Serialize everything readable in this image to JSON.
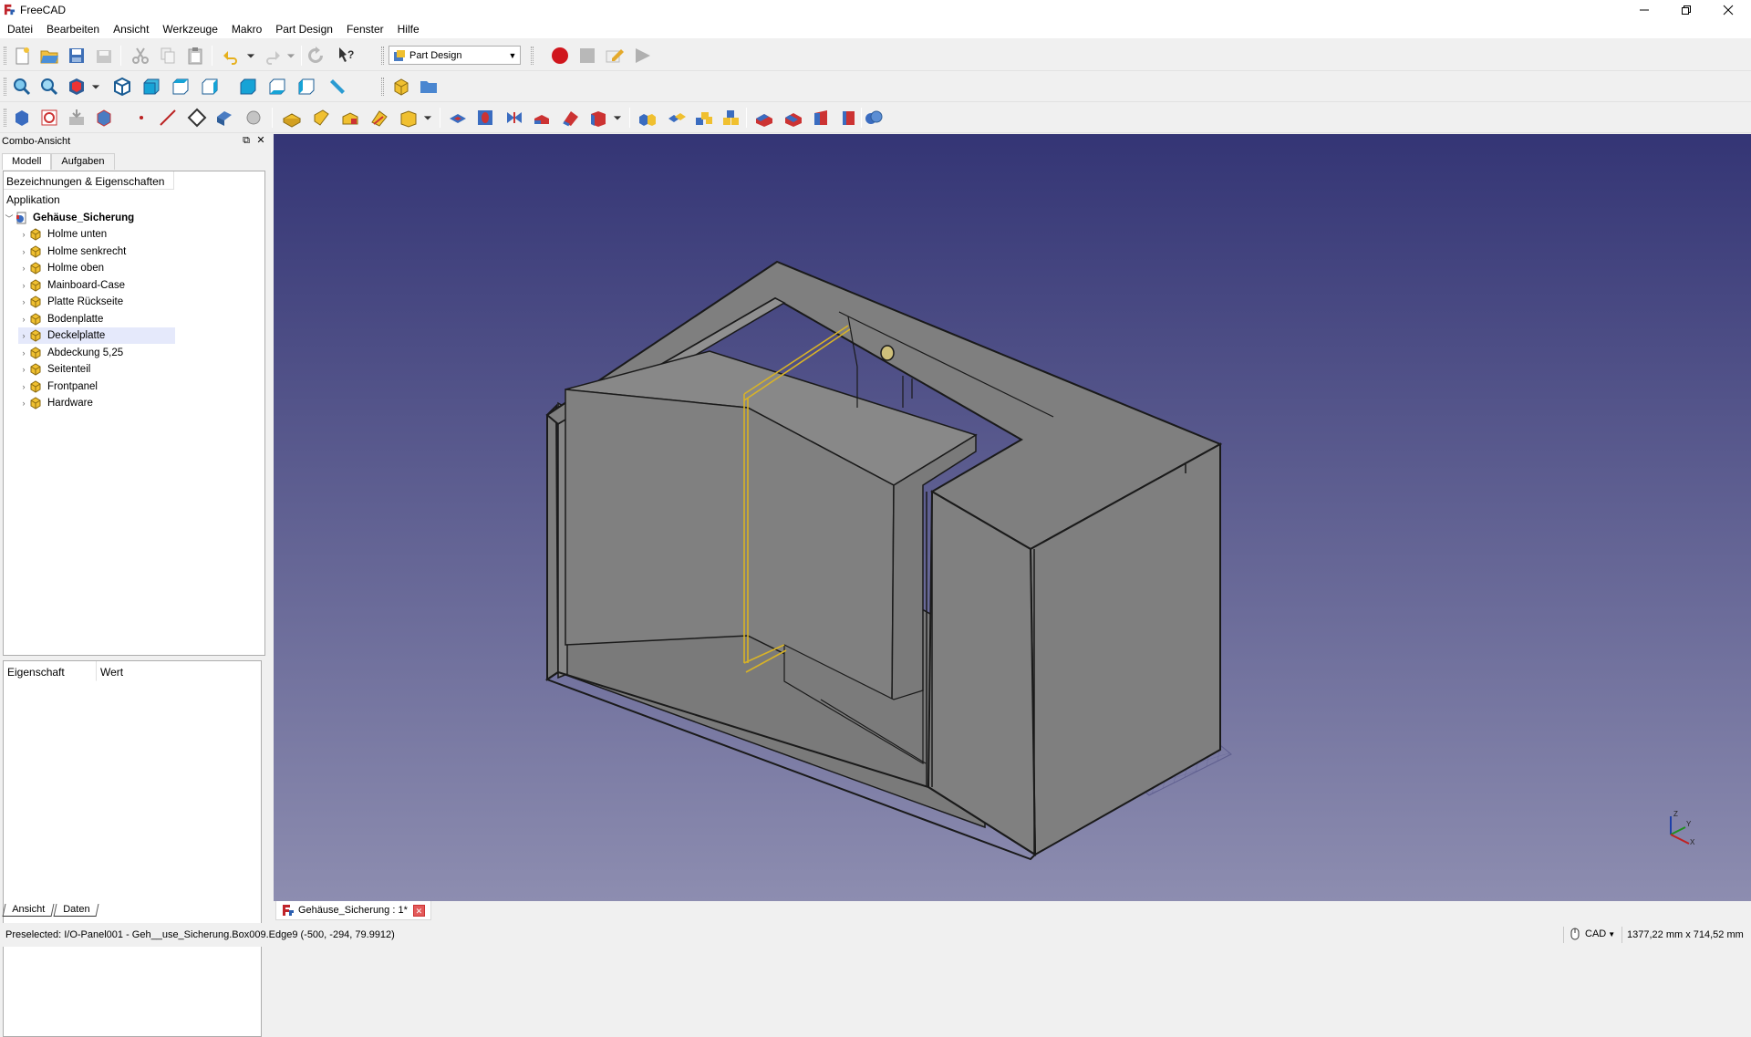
{
  "window": {
    "title": "FreeCAD",
    "controls": [
      "minimize",
      "restore",
      "close"
    ]
  },
  "menu": [
    "Datei",
    "Bearbeiten",
    "Ansicht",
    "Werkzeuge",
    "Makro",
    "Part Design",
    "Fenster",
    "Hilfe"
  ],
  "workbench": {
    "selected": "Part Design"
  },
  "toolbar_icons": {
    "row1": [
      "new-document-icon",
      "open-icon",
      "save-icon",
      "save-as-icon",
      "cut-icon",
      "copy-icon",
      "paste-icon",
      "undo-icon",
      "redo-icon",
      "refresh-icon",
      "whats-this-icon",
      "macro-record-icon",
      "macro-stop-icon",
      "macro-edit-icon",
      "macro-run-icon"
    ],
    "row2": [
      "fit-all-icon",
      "fit-selection-icon",
      "draw-style-icon",
      "isometric-view-icon",
      "front-view-icon",
      "top-view-icon",
      "right-view-icon",
      "rear-view-icon",
      "bottom-view-icon",
      "left-view-icon",
      "measure-distance-icon",
      "create-part-icon",
      "create-group-icon"
    ],
    "row3": [
      "create-body-icon",
      "create-sketch-icon",
      "validate-sketch-icon",
      "shape-binder-icon",
      "datum-point-icon",
      "datum-line-icon",
      "datum-plane-icon",
      "local-coordinate-system-icon",
      "clone-icon",
      "pad-icon",
      "revolution-icon",
      "additive-loft-icon",
      "additive-pipe-icon",
      "additive-primitive-icon",
      "pocket-icon",
      "hole-icon",
      "groove-icon",
      "subtractive-loft-icon",
      "subtractive-pipe-icon",
      "subtractive-primitive-icon",
      "mirrored-icon",
      "linear-pattern-icon",
      "polar-pattern-icon",
      "multi-transform-icon",
      "fillet-icon",
      "chamfer-icon",
      "draft-icon",
      "thickness-icon",
      "boolean-icon"
    ]
  },
  "combo": {
    "title": "Combo-Ansicht",
    "tabs": [
      "Modell",
      "Aufgaben"
    ],
    "tree_header": "Bezeichnungen & Eigenschaften",
    "app_label": "Applikation",
    "root": "Gehäuse_Sicherung",
    "items": [
      "Holme unten",
      "Holme senkrecht",
      "Holme oben",
      "Mainboard-Case",
      "Platte Rückseite",
      "Bodenplatte",
      "Deckelplatte",
      "Abdeckung 5,25",
      "Seitenteil",
      "Frontpanel",
      "Hardware"
    ],
    "selected_item": "Deckelplatte",
    "prop_headers": [
      "Eigenschaft",
      "Wert"
    ],
    "bottom_tabs": [
      "Ansicht",
      "Daten"
    ]
  },
  "document_tab": {
    "label": "Gehäuse_Sicherung : 1*"
  },
  "axis_labels": {
    "z": "Z",
    "y": "Y",
    "x": "X"
  },
  "status": {
    "preselected": "Preselected: I/O-Panel001 - Geh__use_Sicherung.Box009.Edge9 (-500, -294, 79.9912)",
    "nav_style": "CAD",
    "dimensions": "1377,22 mm x 714,52 mm"
  },
  "colors": {
    "viewport_top": "#343575",
    "viewport_bottom": "#8d8db0",
    "model_face": "#7f7f7f",
    "edge": "#1a1a1a",
    "highlight_edge": "#d8b327",
    "selection_bg": "#e5e9fb"
  }
}
